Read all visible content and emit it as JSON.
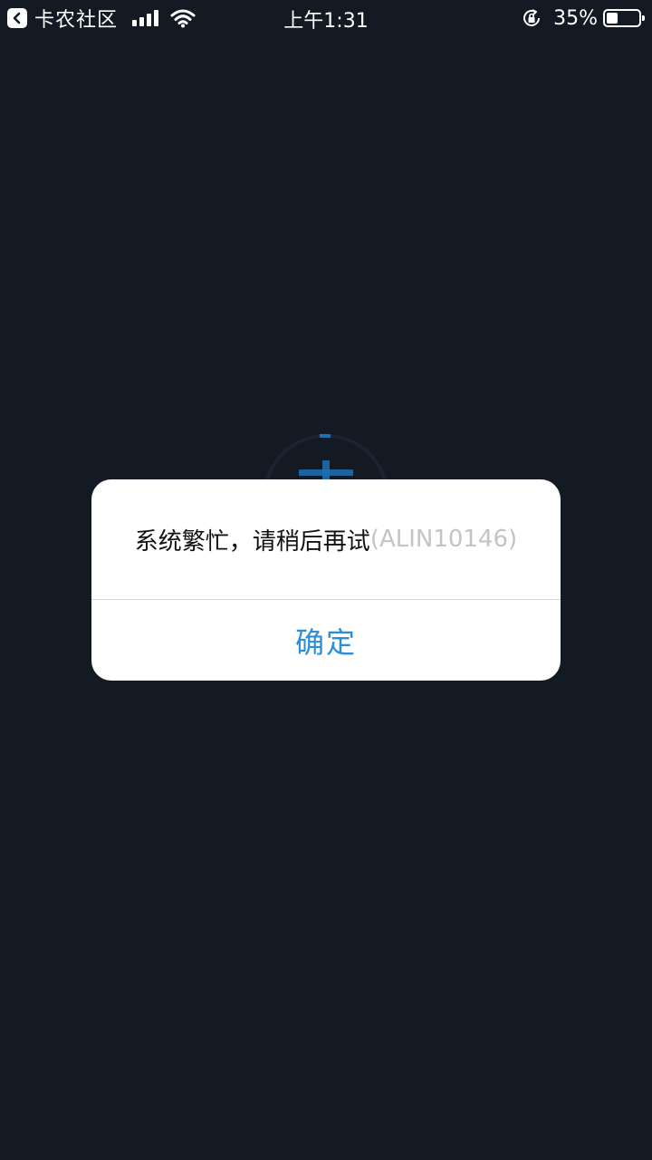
{
  "status_bar": {
    "back_app_label": "卡农社区",
    "time": "上午1:31",
    "battery_percent": "35%",
    "battery_level": 0.35,
    "icons": [
      "back-chevron-icon",
      "signal-icon",
      "wifi-icon",
      "rotation-lock-icon",
      "battery-icon"
    ]
  },
  "dialog": {
    "message": "系统繁忙，请稍后再试",
    "error_code": "(ALIN10146)",
    "confirm_label": "确定"
  },
  "colors": {
    "background": "#141a24",
    "dialog_background": "#ffffff",
    "confirm_text": "#2b8ed8",
    "error_code_text": "#c4c4c4",
    "spinner_accent": "#1f6fb3"
  }
}
